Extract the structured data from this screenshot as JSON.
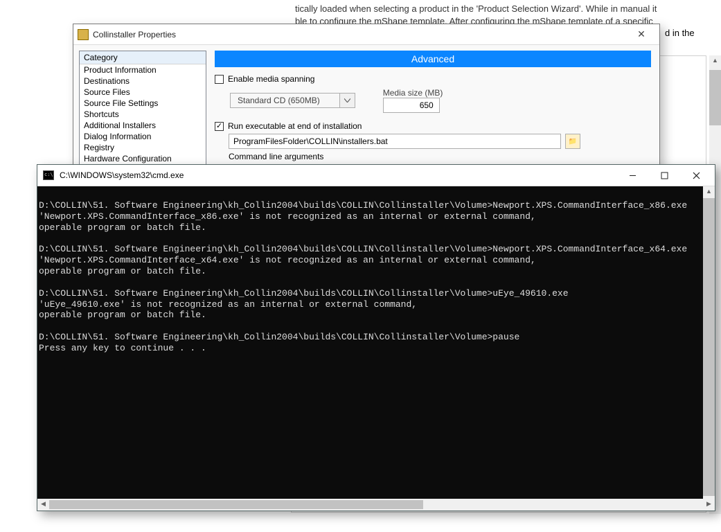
{
  "background": {
    "line1_pre": "tically loaded when selecting a product in the 'Product Selection Wizard'. While in manual it",
    "line2_a": "ble to configure the ",
    "line2_u1": "mShape",
    "line2_b": " template. After configuring the ",
    "line2_u2": "mShape",
    "line2_c": " template of a specific",
    "tail": "d in the"
  },
  "propdlg": {
    "title": "Collinstaller Properties",
    "categories_header": "Category",
    "categories": [
      "Product Information",
      "Destinations",
      "Source Files",
      "Source File Settings",
      "Shortcuts",
      "Additional Installers",
      "Dialog Information",
      "Registry",
      "Hardware Configuration"
    ],
    "advanced_label": "Advanced",
    "enable_media_label": "Enable media spanning",
    "media_combo_value": "Standard CD (650MB)",
    "media_size_label": "Media size (MB)",
    "media_size_value": "650",
    "run_exec_label": "Run executable at end of installation",
    "exec_path": "ProgramFilesFolder\\COLLIN\\installers.bat",
    "cla_label": "Command line arguments"
  },
  "cmd": {
    "title": "C:\\WINDOWS\\system32\\cmd.exe",
    "lines": [
      "",
      "D:\\COLLIN\\51. Software Engineering\\kh_Collin2004\\builds\\COLLIN\\Collinstaller\\Volume>Newport.XPS.CommandInterface_x86.exe",
      "'Newport.XPS.CommandInterface_x86.exe' is not recognized as an internal or external command,",
      "operable program or batch file.",
      "",
      "D:\\COLLIN\\51. Software Engineering\\kh_Collin2004\\builds\\COLLIN\\Collinstaller\\Volume>Newport.XPS.CommandInterface_x64.exe",
      "'Newport.XPS.CommandInterface_x64.exe' is not recognized as an internal or external command,",
      "operable program or batch file.",
      "",
      "D:\\COLLIN\\51. Software Engineering\\kh_Collin2004\\builds\\COLLIN\\Collinstaller\\Volume>uEye_49610.exe",
      "'uEye_49610.exe' is not recognized as an internal or external command,",
      "operable program or batch file.",
      "",
      "D:\\COLLIN\\51. Software Engineering\\kh_Collin2004\\builds\\COLLIN\\Collinstaller\\Volume>pause",
      "Press any key to continue . . ."
    ]
  }
}
